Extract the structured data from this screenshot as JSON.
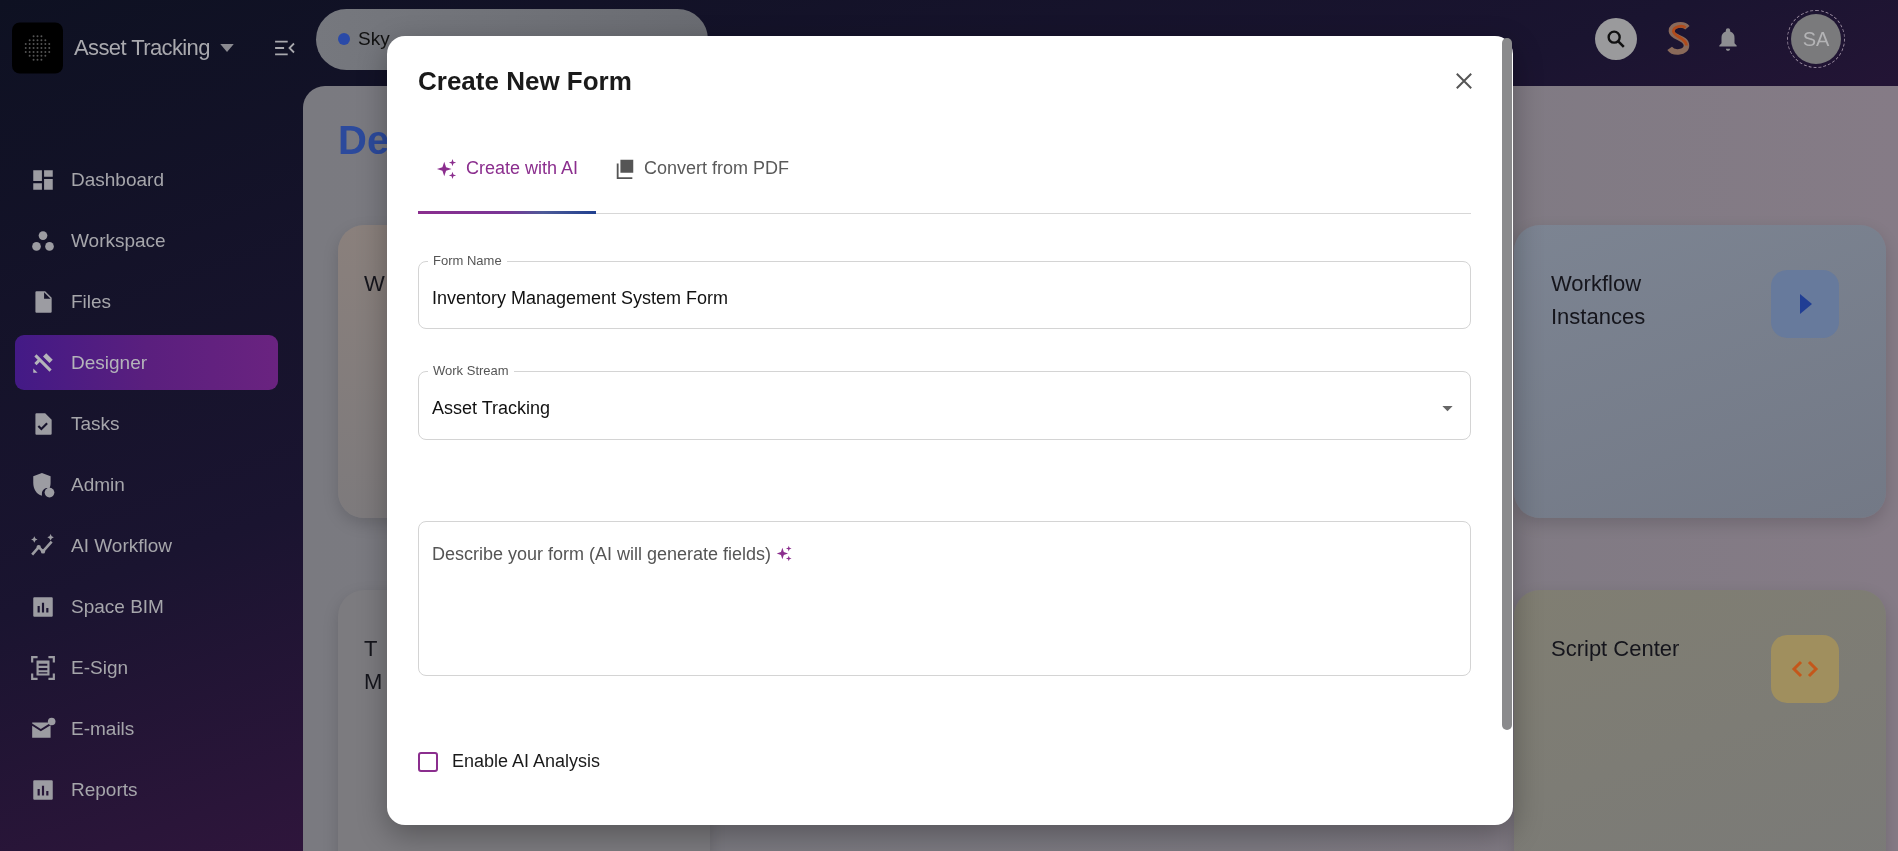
{
  "sidebar": {
    "brand": {
      "title": "Asset Tracking"
    },
    "items": [
      {
        "label": "Dashboard",
        "selected": false
      },
      {
        "label": "Workspace",
        "selected": false
      },
      {
        "label": "Files",
        "selected": false
      },
      {
        "label": "Designer",
        "selected": true
      },
      {
        "label": "Tasks",
        "selected": false
      },
      {
        "label": "Admin",
        "selected": false
      },
      {
        "label": "AI Workflow",
        "selected": false
      },
      {
        "label": "Space BIM",
        "selected": false
      },
      {
        "label": "E-Sign",
        "selected": false
      },
      {
        "label": "E-mails",
        "selected": false
      },
      {
        "label": "Reports",
        "selected": false
      }
    ]
  },
  "header": {
    "workspace_chip": {
      "label": "Sky"
    },
    "avatar": {
      "initials": "SA"
    }
  },
  "main": {
    "heading": "De",
    "cards": [
      {
        "title_lines": [
          "W"
        ]
      },
      {
        "title_lines": [
          "Workflow",
          "Instances"
        ]
      },
      {
        "title_lines": [
          "T",
          "M"
        ]
      },
      {
        "title_lines": [
          "Script Center"
        ]
      }
    ]
  },
  "modal": {
    "title": "Create New Form",
    "tabs": [
      {
        "label": "Create with AI",
        "selected": true
      },
      {
        "label": "Convert from PDF",
        "selected": false
      }
    ],
    "fields": [
      {
        "kind": "text",
        "label": "Form Name",
        "value": "Inventory Management System Form"
      },
      {
        "kind": "select",
        "label": "Work Stream",
        "value": "Asset Tracking"
      },
      {
        "kind": "textarea",
        "placeholder": "Describe your form (AI will generate fields)"
      }
    ],
    "checkbox": {
      "label": "Enable AI Analysis",
      "checked": false
    }
  }
}
